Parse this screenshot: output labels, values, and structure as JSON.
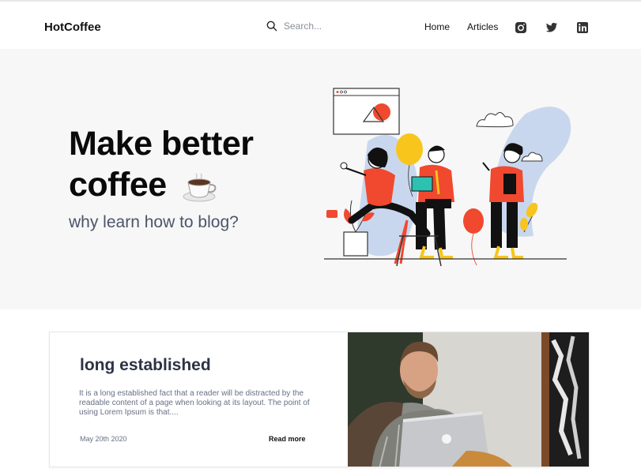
{
  "header": {
    "brand": "HotCoffee",
    "search_placeholder": "Search...",
    "nav": [
      "Home",
      "Articles"
    ],
    "social_icons": [
      "instagram-icon",
      "twitter-icon",
      "linkedin-icon"
    ]
  },
  "hero": {
    "title_line1": "Make better",
    "title_line2": "coffee",
    "emoji": "coffee-cup-icon",
    "subtitle": "why learn how to blog?"
  },
  "article": {
    "title": "long established",
    "excerpt": "It is a long established fact that a reader will be distracted by the readable content of a page when looking at its layout. The point of using Lorem Ipsum is that....",
    "date": "May 20th 2020",
    "read_more": "Read more"
  },
  "colors": {
    "accent_red": "#f0492f",
    "accent_yellow": "#f7c51c",
    "accent_blue": "#c9d7ee",
    "hero_bg": "#f7f7f7"
  }
}
